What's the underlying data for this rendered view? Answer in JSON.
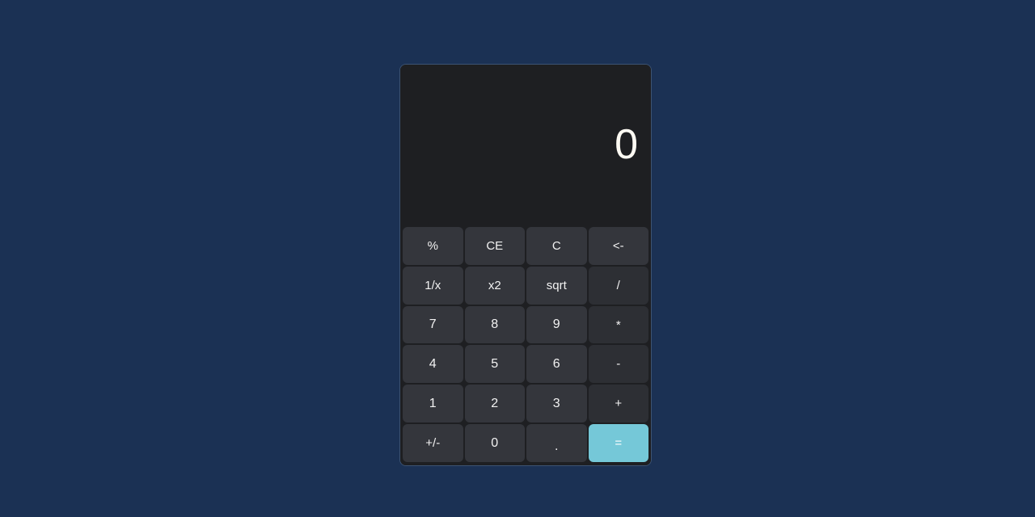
{
  "app": {
    "name": "calculator",
    "background_color": "#1b3154",
    "body_color": "#1e1f22",
    "border_color": "#3c5372"
  },
  "display": {
    "value": "0",
    "text_color": "#fdfaf3",
    "background_color": "#1e1f22",
    "align": "right"
  },
  "keypad": {
    "columns": 4,
    "rows": 6,
    "key_color": "#34363c",
    "operator_color": "#2d2f34",
    "accent_color": "#75c8d8",
    "key_text_color": "#f2f2f2",
    "keys": [
      {
        "label": "%",
        "name": "key-percent",
        "kind": "func"
      },
      {
        "label": "CE",
        "name": "key-clear-entry",
        "kind": "func"
      },
      {
        "label": "C",
        "name": "key-clear",
        "kind": "func"
      },
      {
        "label": "<-",
        "name": "key-backspace",
        "kind": "func"
      },
      {
        "label": "1/x",
        "name": "key-reciprocal",
        "kind": "func"
      },
      {
        "label": "x2",
        "name": "key-square",
        "kind": "func"
      },
      {
        "label": "sqrt",
        "name": "key-square-root",
        "kind": "func"
      },
      {
        "label": "/",
        "name": "key-divide",
        "kind": "op"
      },
      {
        "label": "7",
        "name": "key-7",
        "kind": "digit"
      },
      {
        "label": "8",
        "name": "key-8",
        "kind": "digit"
      },
      {
        "label": "9",
        "name": "key-9",
        "kind": "digit"
      },
      {
        "label": "*",
        "name": "key-multiply",
        "kind": "op"
      },
      {
        "label": "4",
        "name": "key-4",
        "kind": "digit"
      },
      {
        "label": "5",
        "name": "key-5",
        "kind": "digit"
      },
      {
        "label": "6",
        "name": "key-6",
        "kind": "digit"
      },
      {
        "label": "-",
        "name": "key-subtract",
        "kind": "op"
      },
      {
        "label": "1",
        "name": "key-1",
        "kind": "digit"
      },
      {
        "label": "2",
        "name": "key-2",
        "kind": "digit"
      },
      {
        "label": "3",
        "name": "key-3",
        "kind": "digit"
      },
      {
        "label": "+",
        "name": "key-add",
        "kind": "op"
      },
      {
        "label": "+/-",
        "name": "key-sign-toggle",
        "kind": "func"
      },
      {
        "label": "0",
        "name": "key-0",
        "kind": "digit"
      },
      {
        "label": ".",
        "name": "key-decimal",
        "kind": "dot"
      },
      {
        "label": "=",
        "name": "key-equals",
        "kind": "equals"
      }
    ]
  }
}
